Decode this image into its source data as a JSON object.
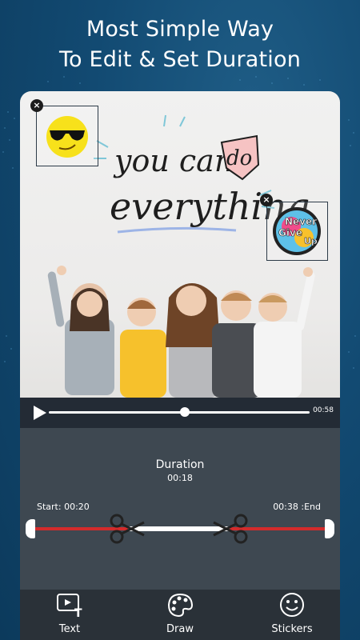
{
  "headline": {
    "line1": "Most Simple Way",
    "line2": "To Edit & Set Duration"
  },
  "canvas": {
    "lettering": {
      "line1": "you can",
      "line1b": "do",
      "line2": "everything"
    },
    "stickers": [
      {
        "name": "sunglasses-emoji",
        "close": "×"
      },
      {
        "name": "never-give-up",
        "text": [
          "Never",
          "Give",
          "Up"
        ],
        "close": "×"
      }
    ]
  },
  "player": {
    "progress": 0.52,
    "time": "00:58"
  },
  "trim": {
    "title": "Duration",
    "duration": "00:18",
    "start_label": "Start: 00:20",
    "end_label": "00:38 :End",
    "selection_start": 0.32,
    "selection_end": 0.67
  },
  "toolbar": {
    "items": [
      {
        "label": "Text",
        "icon": "text-icon"
      },
      {
        "label": "Draw",
        "icon": "palette-icon"
      },
      {
        "label": "Stickers",
        "icon": "smiley-icon"
      }
    ]
  },
  "colors": {
    "accent_red": "#d32b2b",
    "panel": "#3e4851",
    "toolbar": "#2a3138"
  }
}
